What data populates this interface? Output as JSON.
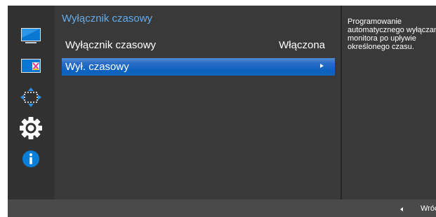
{
  "sidebar": {
    "items": [
      {
        "icon": "monitor-picture-icon"
      },
      {
        "icon": "color-icon"
      },
      {
        "icon": "screen-size-arrows-icon"
      },
      {
        "icon": "settings-gear-icon",
        "selected": true
      },
      {
        "icon": "information-icon"
      }
    ]
  },
  "panel": {
    "title": "Wyłącznik czasowy",
    "items": [
      {
        "label": "Wyłącznik czasowy",
        "value": "Włączona",
        "selected": false
      },
      {
        "label": "Wył. czasowy",
        "value": "",
        "selected": true,
        "has_submenu_arrow": true
      }
    ]
  },
  "help": {
    "text": "Programowanie automatycznego wyłączania monitora po upływie określonego czasu."
  },
  "footer": {
    "back_label": "Wróć"
  },
  "colors": {
    "title_accent": "#63acea",
    "selection": "#0b62c0",
    "panel_background": "#393939",
    "sidebar_background": "#313131",
    "footer_background": "#4a4a4a",
    "info_icon": "#0a7fd9"
  }
}
